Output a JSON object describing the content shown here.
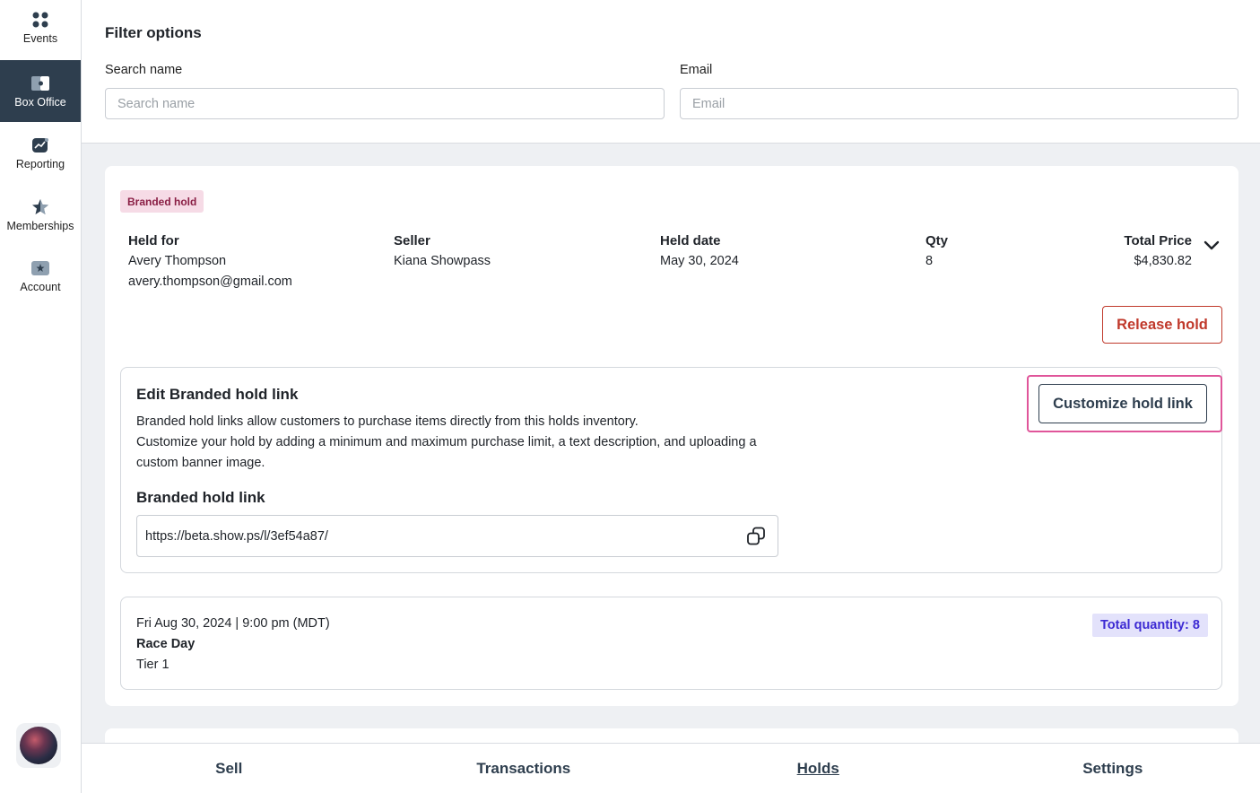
{
  "sidebar": {
    "items": [
      {
        "label": "Events",
        "icon": "grid-icon"
      },
      {
        "label": "Box Office",
        "icon": "ticket-icon"
      },
      {
        "label": "Reporting",
        "icon": "chart-icon"
      },
      {
        "label": "Memberships",
        "icon": "star-icon"
      },
      {
        "label": "Account",
        "icon": "badge-icon"
      }
    ]
  },
  "filters": {
    "title": "Filter options",
    "search_label": "Search name",
    "search_placeholder": "Search name",
    "email_label": "Email",
    "email_placeholder": "Email"
  },
  "hold": {
    "badge": "Branded hold",
    "held_for_label": "Held for",
    "held_for_name": "Avery Thompson",
    "held_for_email": "avery.thompson@gmail.com",
    "seller_label": "Seller",
    "seller": "Kiana Showpass",
    "held_date_label": "Held date",
    "held_date": "May 30, 2024",
    "qty_label": "Qty",
    "qty": "8",
    "total_label": "Total Price",
    "total": "$4,830.82",
    "release_button": "Release hold"
  },
  "link_section": {
    "title": "Edit Branded hold link",
    "desc_line1": "Branded hold links allow customers to purchase items directly from this holds inventory.",
    "desc_line2": "Customize your hold by adding a minimum and maximum purchase limit, a text description, and uploading a custom banner image.",
    "link_title": "Branded hold link",
    "url": "https://beta.show.ps/l/3ef54a87/",
    "customize_button": "Customize hold link"
  },
  "event": {
    "datetime": "Fri Aug 30, 2024 | 9:00 pm (MDT)",
    "name": "Race Day",
    "tier": "Tier 1",
    "total_quantity": "Total quantity: 8"
  },
  "bottom_nav": {
    "tabs": [
      "Sell",
      "Transactions",
      "Holds",
      "Settings"
    ],
    "active": "Holds"
  }
}
